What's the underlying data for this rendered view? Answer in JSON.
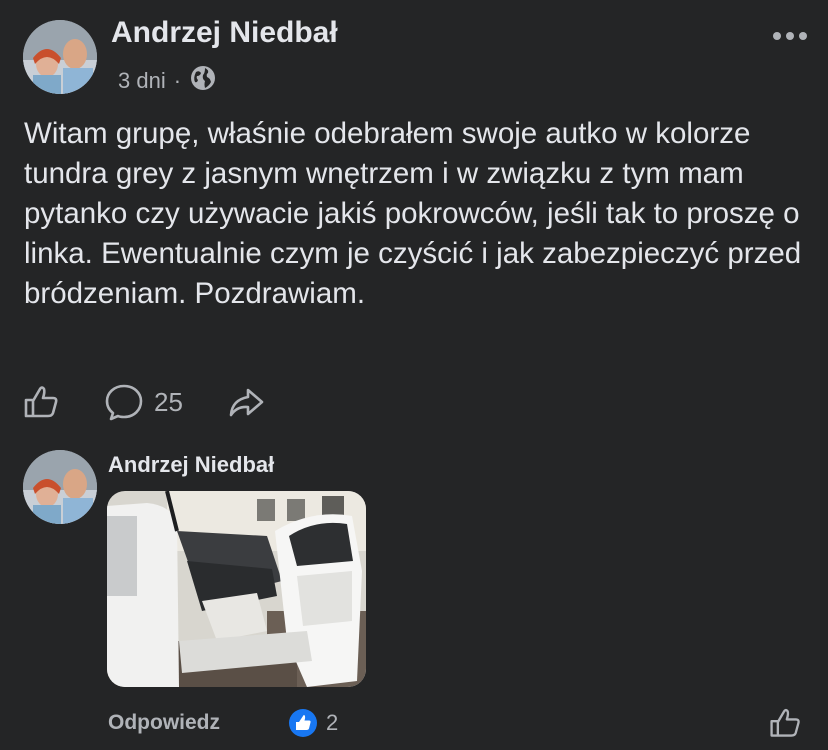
{
  "post": {
    "author": "Andrzej Niedbał",
    "time": "3 dni",
    "separator": "·",
    "audience_icon": "globe-icon",
    "more_icon": "more-dots-icon",
    "text": "Witam grupę, właśnie odebrałem swoje autko w kolorze tundra grey z jasnym wnętrzem i w związku z tym mam pytanko czy używacie jakiś pokrowców, jeśli tak to proszę o linka. Ewentualnie czym je czyścić i jak zabezpieczyć przed bródzeniam. Pozdrawiam.",
    "actions": {
      "like_icon": "thumbs-up-icon",
      "comment_icon": "comment-bubble-icon",
      "comment_count": "25",
      "share_icon": "share-arrow-icon"
    }
  },
  "comment": {
    "author": "Andrzej Niedbał",
    "photo": "car-interior-photo",
    "reply_label": "Odpowiedz",
    "reaction_icon": "like-reaction-icon",
    "reaction_count": "2",
    "like_icon": "thumbs-up-icon"
  },
  "colors": {
    "background": "#242526",
    "primary_text": "#e4e6eb",
    "secondary_text": "#b0b3b8",
    "like_blue": "#1877f2"
  }
}
